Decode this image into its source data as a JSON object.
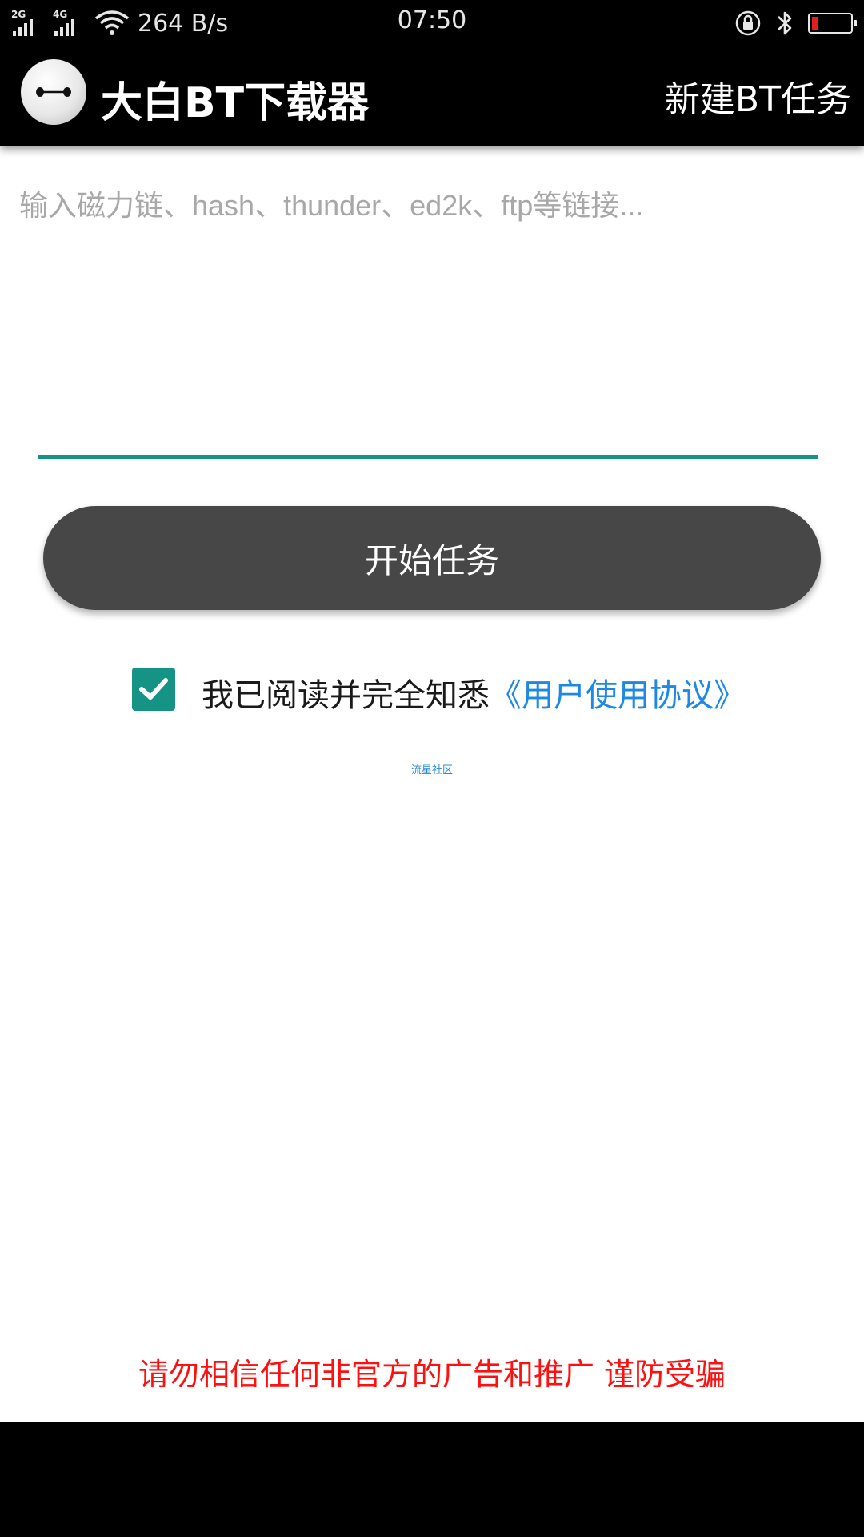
{
  "status_bar": {
    "network_1": "2G",
    "network_2": "4G",
    "net_speed": "264 B/s",
    "time": "07:50",
    "battery_color": "#e02020"
  },
  "app_bar": {
    "title": "大白BT下载器",
    "action_label": "新建BT任务",
    "logo_icon": "baymax-icon"
  },
  "input": {
    "placeholder": "输入磁力链、hash、thunder、ed2k、ftp等链接...",
    "value": "",
    "accent_color": "#159485"
  },
  "start_button": {
    "label": "开始任务"
  },
  "agreement": {
    "checked": true,
    "text": "我已阅读并完全知悉",
    "link_text": "《用户使用协议》",
    "link_color": "#1e88e5"
  },
  "community_link": "流星社区",
  "warning": "请勿相信任何非官方的广告和推广 谨防受骗"
}
